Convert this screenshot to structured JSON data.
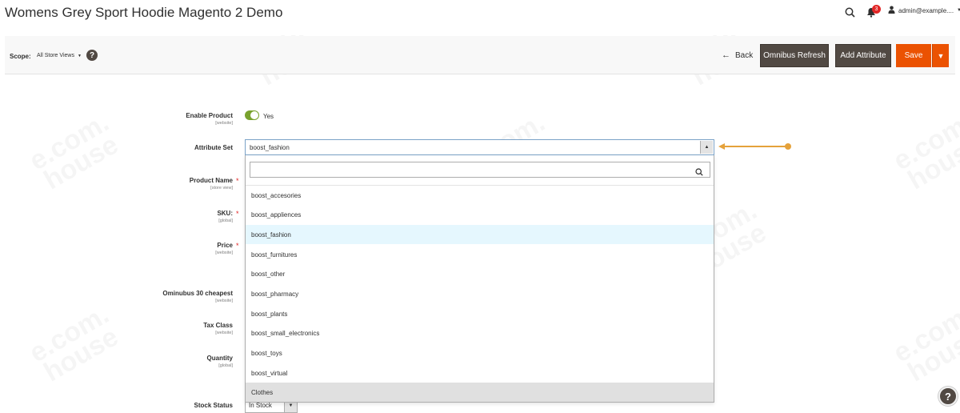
{
  "header": {
    "title": "Womens Grey Sport Hoodie Magento 2 Demo",
    "notification_count": "3",
    "admin_user": "admin@example....",
    "icons": [
      "search-icon",
      "bell-icon",
      "user-icon",
      "chevron-down-icon"
    ]
  },
  "toolbar": {
    "scope_label": "Scope:",
    "scope_value": "All Store Views",
    "help_label": "?",
    "back_label": "Back",
    "omnibus_refresh_label": "Omnibus Refresh",
    "add_attribute_label": "Add Attribute",
    "save_label": "Save",
    "colors": {
      "dark_button": "#514943",
      "save_button": "#eb5202"
    }
  },
  "form": {
    "enable_product": {
      "label": "Enable Product",
      "scope": "[website]",
      "value": "Yes",
      "enabled": true
    },
    "attribute_set": {
      "label": "Attribute Set",
      "value": "boost_fashion"
    },
    "product_name": {
      "label": "Product Name",
      "scope": "[store view]",
      "required": "*"
    },
    "sku": {
      "label": "SKU:",
      "scope": "[global]",
      "required": "*"
    },
    "price": {
      "label": "Price",
      "scope": "[website]",
      "required": "*"
    },
    "omnibus": {
      "label": "Ominubus 30 cheapest",
      "scope": "[website]"
    },
    "tax_class": {
      "label": "Tax Class",
      "scope": "[website]"
    },
    "quantity": {
      "label": "Quantity",
      "scope": "[global]"
    },
    "stock_status": {
      "label": "Stock Status",
      "value": "In Stock"
    }
  },
  "dropdown": {
    "search_value": "",
    "options": [
      "boost_accesories",
      "boost_appliences",
      "boost_fashion",
      "boost_furnitures",
      "boost_other",
      "boost_pharmacy",
      "boost_plants",
      "boost_small_electronics",
      "boost_toys",
      "boost_virtual",
      "Clothes"
    ],
    "selected": "boost_fashion",
    "colors": {
      "selected_bg": "#e5f7fe",
      "hover_bg": "#e0e0e0",
      "annotation": "#e5a23b"
    }
  },
  "help_bubble": "?"
}
